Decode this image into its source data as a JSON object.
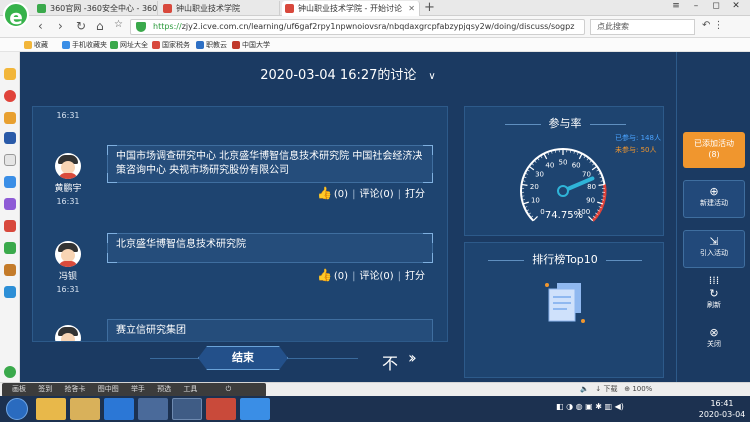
{
  "browser": {
    "tabs": [
      {
        "label": "360官网 -360安全中心 - 360安",
        "active": false
      },
      {
        "label": "钟山职业技术学院",
        "active": false
      },
      {
        "label": "钟山职业技术学院 - 开始讨论",
        "active": true
      }
    ],
    "new_tab": "+",
    "url_https": "https://",
    "url_rest": "zjy2.icve.com.cn/learning/uf6gaf2rpy1npwnoiovsra/nbqdaxgrcpfabzypjqsy2w/doing/discuss/sogpz",
    "search_placeholder": "点此搜索",
    "bookmarks": [
      "收藏",
      "手机收藏夹",
      "网址大全",
      "国家税务",
      "职教云",
      "中国大学"
    ]
  },
  "discussion": {
    "title": "2020-03-04 16:27的讨论",
    "first_time": "16:31",
    "posts": [
      {
        "user": "黄鹏宇",
        "time": "16:31",
        "content": "中国市场调查研究中心 北京盛华博智信息技术研究院 中国社会经济决策咨询中心 央视市场研究股份有限公司",
        "likes": "(0)",
        "comments": "评论(0)",
        "rate": "打分"
      },
      {
        "user": "冯钡",
        "time": "16:31",
        "content": "北京盛华博智信息技术研究院",
        "likes": "(0)",
        "comments": "评论(0)",
        "rate": "打分"
      },
      {
        "user": "",
        "time": "",
        "content": "赛立信研究集团",
        "likes": "",
        "comments": "",
        "rate": ""
      }
    ],
    "end_label": "结束"
  },
  "participation": {
    "title": "参与率",
    "joined": "已参与: 148人",
    "not_joined": "未参与: 50人",
    "rate_label": "74.75%",
    "rate_value": 74.75,
    "gauge_ticks": [
      "0",
      "10",
      "20",
      "30",
      "40",
      "50",
      "60",
      "70",
      "80",
      "90",
      "100"
    ],
    "colors": {
      "joined": "#4aa3ff",
      "not_joined": "#f0962e",
      "needle": "#2fb4d8"
    }
  },
  "ranking": {
    "title": "排行榜Top10"
  },
  "rail": {
    "added": "已添加活动",
    "added_count": "(8)",
    "new_activity": "新建活动",
    "import_activity": "引入活动",
    "refresh": "刷新",
    "close": "关闭"
  },
  "statusbar": {
    "tools": [
      "画板",
      "签到",
      "抢答卡",
      "图中图",
      "举手",
      "预选",
      "工具"
    ],
    "download": "下载",
    "zoom": "100%"
  },
  "taskbar": {
    "time": "16:41",
    "date": "2020-03-04"
  }
}
